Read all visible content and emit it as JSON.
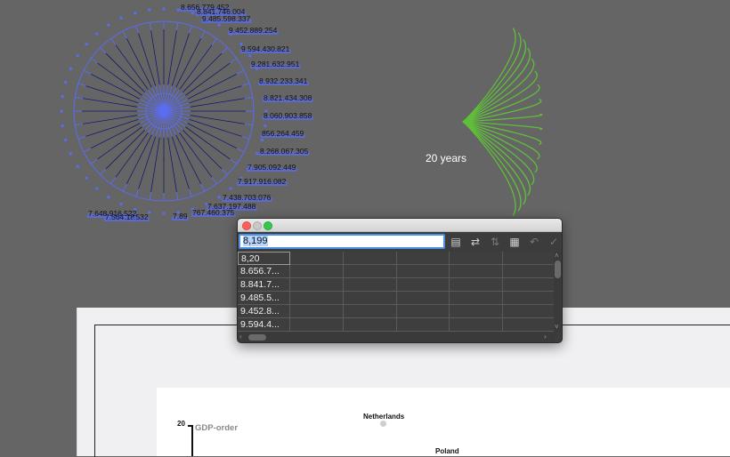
{
  "canvas": {
    "pie_labels": [
      "8.656.779.452",
      "8.841.746.004",
      "9.485.598.337",
      "9.452.889.254",
      "9.594.430.821",
      "9.281.632.951",
      "8.932.233.341",
      "8.821.434.308",
      "8.060.903.858",
      "856.264.459",
      "8.268.067.305",
      "7.905.092.449",
      "7.917.916.082",
      "7.438.703.076",
      "7.637.197.488",
      "767.460.375",
      "7.89",
      "7.648.916.522",
      "7.564.18",
      ".532"
    ],
    "years_label": "20 years",
    "colors": {
      "background": "#656565",
      "radial": "#5a6cf0",
      "fan": "#5fbf3a"
    }
  },
  "data_window": {
    "cell_value": "8,199",
    "toolbar_icons": [
      "import-data-icon",
      "transpose-icon",
      "switch-xy-icon",
      "cell-style-icon",
      "revert-icon",
      "apply-icon"
    ],
    "rows": [
      "8,20",
      "8.656.7...",
      "8.841.7...",
      "9.485.5...",
      "9.452.8...",
      "9.594.4..."
    ]
  },
  "document": {
    "axis_value": "20",
    "axis_title": "GDP-order",
    "countries": [
      "Netherlands",
      "Poland"
    ]
  }
}
